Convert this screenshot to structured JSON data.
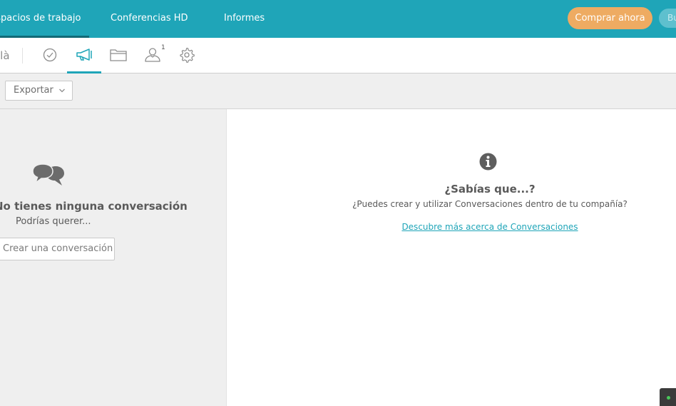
{
  "topnav": {
    "items": [
      {
        "label": "Espacios de trabajo",
        "active": true
      },
      {
        "label": "Conferencias HD",
        "active": false
      },
      {
        "label": "Informes",
        "active": false
      }
    ],
    "buy_label": "Comprar ahora",
    "search_label": "Bu"
  },
  "toolbar": {
    "project_name": "ilà",
    "icons": [
      "check-circle-icon",
      "megaphone-icon",
      "folder-icon",
      "user-icon",
      "gear-icon"
    ],
    "active_icon": "megaphone-icon",
    "user_count": "1"
  },
  "filterbar": {
    "export_label": "Exportar"
  },
  "left_panel": {
    "empty_title": "No tienes ninguna conversación",
    "empty_subtitle": "Podrías querer...",
    "create_label": "Crear una conversación"
  },
  "right_panel": {
    "tip_title": "¿Sabías que...?",
    "tip_body": "¿Puedes crear y utilizar Conversaciones dentro de tu compañía?",
    "tip_link": "Descubre más acerca de Conversaciones"
  },
  "colors": {
    "brand": "#1fa5b8",
    "buy_button": "#eeab62",
    "panel_bg": "#efefef",
    "text": "#5a5a5a"
  }
}
